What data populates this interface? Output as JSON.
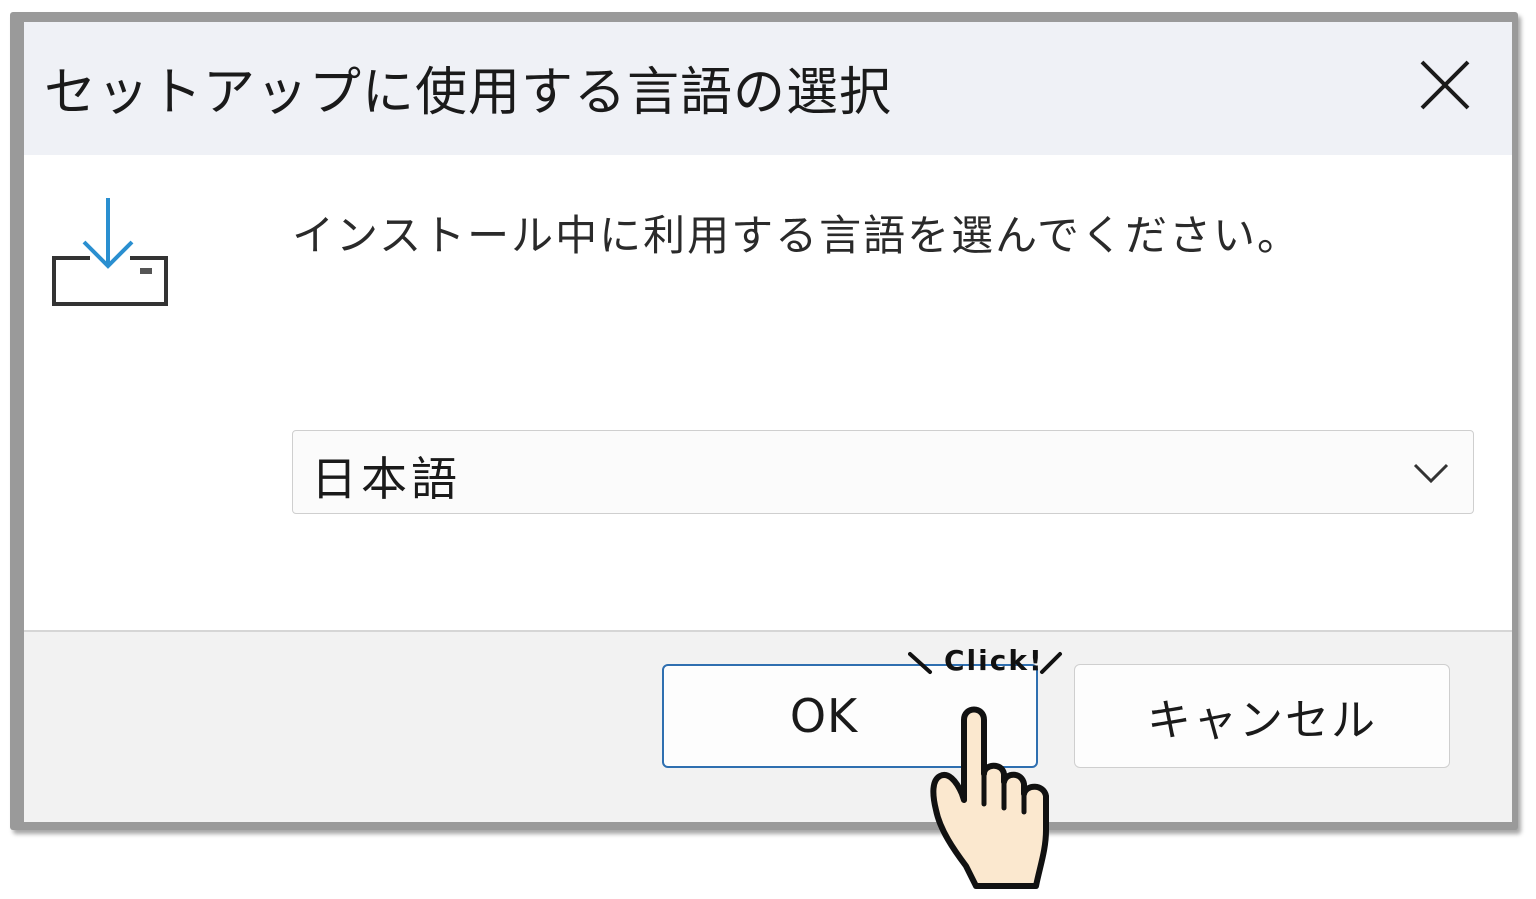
{
  "dialog": {
    "title": "セットアップに使用する言語の選択",
    "prompt": "インストール中に利用する言語を選んでください。"
  },
  "language_select": {
    "selected": "日本語"
  },
  "buttons": {
    "ok_label": "OK",
    "cancel_label": "キャンセル"
  },
  "annotation": {
    "click_label": "Click!"
  },
  "icons": {
    "close": "close-icon",
    "setup": "download-tray-icon",
    "dropdown": "chevron-down-icon",
    "pointer": "pointing-hand-icon"
  },
  "colors": {
    "titlebar_bg": "#eff1f6",
    "footer_bg": "#f2f2f2",
    "ok_border": "#2f6fb0",
    "icon_blue": "#2a8fd0",
    "hand_fill": "#fbe8cf"
  }
}
